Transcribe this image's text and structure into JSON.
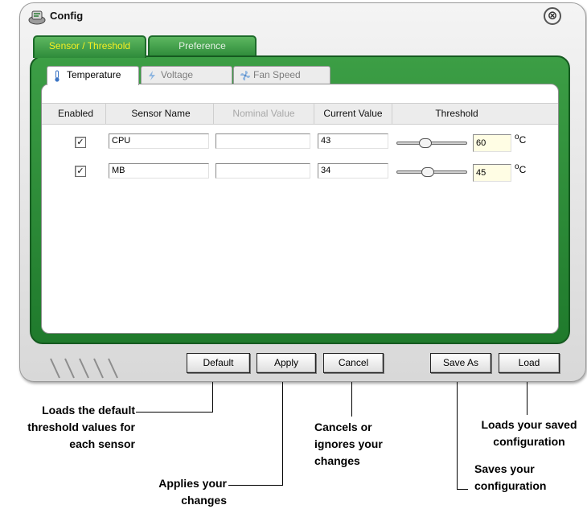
{
  "window": {
    "title": "Config",
    "close_symbol": "⊗"
  },
  "outer_tabs": [
    {
      "label": "Sensor / Threshold",
      "active": true
    },
    {
      "label": "Preference",
      "active": false
    }
  ],
  "inner_tabs": [
    {
      "label": "Temperature",
      "icon": "thermometer-icon",
      "active": true
    },
    {
      "label": "Voltage",
      "icon": "lightning-icon",
      "active": false
    },
    {
      "label": "Fan Speed",
      "icon": "fan-icon",
      "active": false
    }
  ],
  "table": {
    "columns": [
      "Enabled",
      "Sensor Name",
      "Nominal Value",
      "Current Value",
      "Threshold"
    ],
    "rows": [
      {
        "enabled": true,
        "check_mark": "✓",
        "sensor_name": "CPU",
        "nominal_value": "",
        "current_value": "43",
        "threshold_fraction": 0.4,
        "threshold": "60",
        "unit_sup": "o",
        "unit": "C"
      },
      {
        "enabled": true,
        "check_mark": "✓",
        "sensor_name": "MB",
        "nominal_value": "",
        "current_value": "34",
        "threshold_fraction": 0.44,
        "threshold": "45",
        "unit_sup": "o",
        "unit": "C"
      }
    ]
  },
  "buttons": {
    "default": "Default",
    "apply": "Apply",
    "cancel": "Cancel",
    "save_as": "Save As",
    "load": "Load"
  },
  "callouts": {
    "default": "Loads the default\nthreshold values for\neach sensor",
    "apply": "Applies your\nchanges",
    "cancel": "Cancels or\nignores your\nchanges",
    "load": "Loads your saved\nconfiguration",
    "save_as": "Saves your\nconfiguration"
  },
  "colors": {
    "frame_green": "#2e8b3a",
    "active_tab_text": "#f5ef22",
    "threshold_field": "#fffde4"
  }
}
